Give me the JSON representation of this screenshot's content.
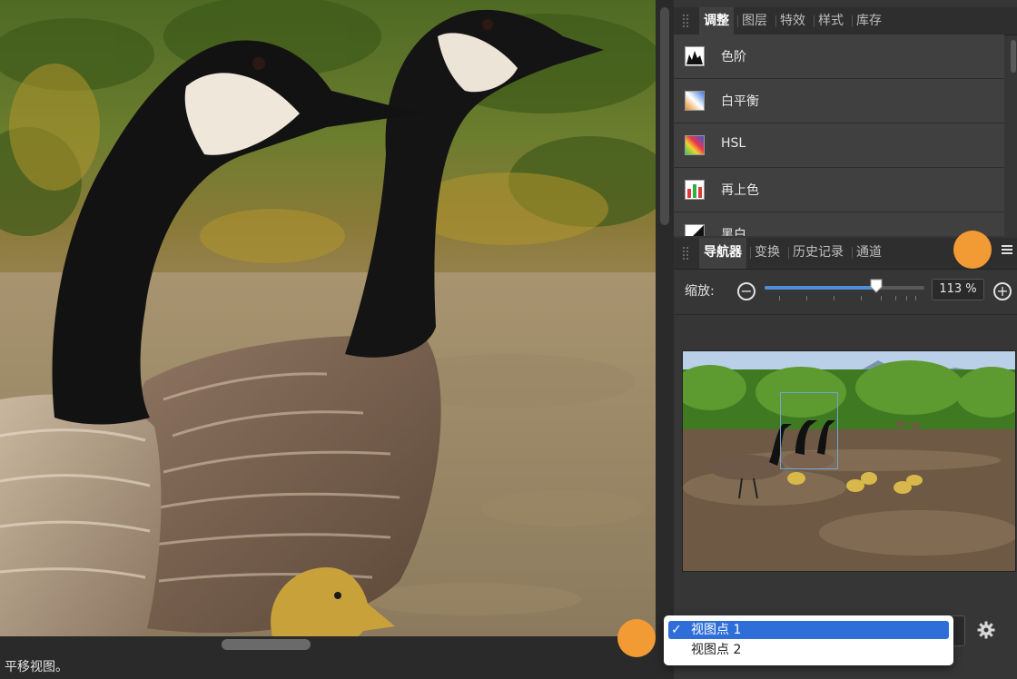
{
  "canvas": {
    "status_text": "平移视图。"
  },
  "adjustments_panel": {
    "tabs": [
      "调整",
      "图层",
      "特效",
      "样式",
      "库存"
    ],
    "active_tab": "调整",
    "items": [
      {
        "label": "色阶",
        "icon": "levels-icon"
      },
      {
        "label": "白平衡",
        "icon": "white-balance-icon"
      },
      {
        "label": "HSL",
        "icon": "hsl-icon"
      },
      {
        "label": "再上色",
        "icon": "recolor-icon"
      },
      {
        "label": "黑白",
        "icon": "black-white-icon"
      }
    ]
  },
  "navigator_panel": {
    "tabs": [
      "导航器",
      "变换",
      "历史记录",
      "通道"
    ],
    "active_tab": "导航器",
    "zoom_label": "缩放:",
    "zoom_value": "113 %",
    "zoom_slider_fraction": 0.7
  },
  "viewpoint_menu": {
    "options": [
      {
        "label": "视图点 1",
        "checked": true
      },
      {
        "label": "视图点 2",
        "checked": false
      }
    ],
    "check_glyph": "✓"
  },
  "colors": {
    "accent_blue": "#2f6ed8",
    "marker_orange": "#f29a34",
    "panel_bg": "#363636"
  }
}
